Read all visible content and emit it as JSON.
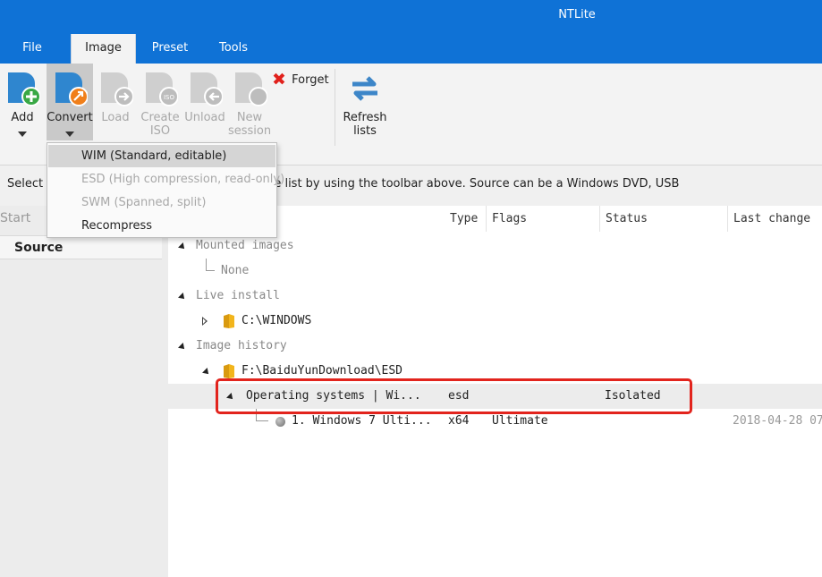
{
  "window": {
    "title": "NTLite"
  },
  "tabs": [
    {
      "label": "File"
    },
    {
      "label": "Image",
      "active": true
    },
    {
      "label": "Preset"
    },
    {
      "label": "Tools"
    }
  ],
  "ribbon": {
    "buttons": [
      {
        "label": "Add",
        "icon": "add-image-icon",
        "has_dropdown": true,
        "enabled": true
      },
      {
        "label": "Convert",
        "icon": "convert-image-icon",
        "has_dropdown": true,
        "enabled": true,
        "pressed": true
      },
      {
        "label": "Load",
        "icon": "load-image-icon",
        "enabled": false
      },
      {
        "label": "Create\nISO",
        "icon": "create-iso-icon",
        "enabled": false
      },
      {
        "label": "Unload",
        "icon": "unload-image-icon",
        "enabled": false
      },
      {
        "label": "New\nsession",
        "icon": "new-session-icon",
        "enabled": false
      }
    ],
    "forget": {
      "label": "Forget",
      "icon": "red-x-icon"
    },
    "refresh": {
      "label": "Refresh\nlists",
      "icon": "refresh-arrows-icon"
    }
  },
  "convert_menu": {
    "items": [
      {
        "label": "WIM (Standard, editable)",
        "selected": true,
        "enabled": true
      },
      {
        "label": "ESD (High compression, read-only)",
        "enabled": false
      },
      {
        "label": "SWM (Spanned, split)",
        "enabled": false
      },
      {
        "label": "Recompress",
        "enabled": true
      }
    ]
  },
  "info_text": "Select a source below, or add a new one to the list by using the toolbar above. Source can be a Windows DVD, USB",
  "left_panel": {
    "items": [
      {
        "label": "Start"
      },
      {
        "label": "Source",
        "selected": true
      }
    ]
  },
  "columns": [
    "Type",
    "Flags",
    "Status",
    "Last change"
  ],
  "tree": {
    "mounted_images": {
      "label": "Mounted images",
      "child": "None"
    },
    "live_install": {
      "label": "Live install",
      "child": "C:\\WINDOWS"
    },
    "image_history": {
      "label": "Image history",
      "folder": "F:\\BaiduYunDownload\\ESD",
      "image_row": {
        "name": "Operating systems  |  Wi...",
        "type": "esd",
        "status": "Isolated"
      },
      "edition_row": {
        "name": "1. Windows 7 Ulti...",
        "type": "x64",
        "flags": "Ultimate",
        "last_change": "2018-04-28 07"
      }
    }
  },
  "colors": {
    "title_bar": "#0f72d6",
    "highlight_box": "#e2241d",
    "folder": "#f2b51c"
  }
}
